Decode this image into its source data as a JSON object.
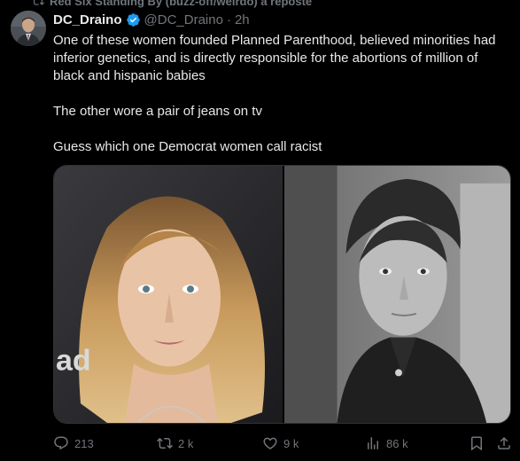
{
  "repost_context": "Red Six Standing By (buzz-off/weirdo) a reposté",
  "tweet": {
    "author_name": "DC_Draino",
    "author_handle": "@DC_Draino",
    "separator": "·",
    "time": "2h",
    "paragraphs": [
      "One of these women founded Planned Parenthood, believed minorities had inferior genetics, and is directly responsible for the abortions of million of black and hispanic babies",
      "The other wore a pair of jeans on tv",
      "Guess which one Democrat women call racist"
    ],
    "media_overlay_text": "ad"
  },
  "actions": {
    "replies": "213",
    "reposts": "2 k",
    "likes": "9 k",
    "views": "86 k"
  },
  "icons": {
    "repost_context": "repost-icon",
    "verified": "verified-badge-icon",
    "reply": "reply-icon",
    "repost": "repost-icon",
    "like": "heart-icon",
    "views": "views-icon",
    "bookmark": "bookmark-icon",
    "share": "share-icon"
  },
  "colors": {
    "background": "#000000",
    "text": "#e7e9ea",
    "muted": "#71767b",
    "verified": "#1d9bf0",
    "border": "#2f3336"
  }
}
